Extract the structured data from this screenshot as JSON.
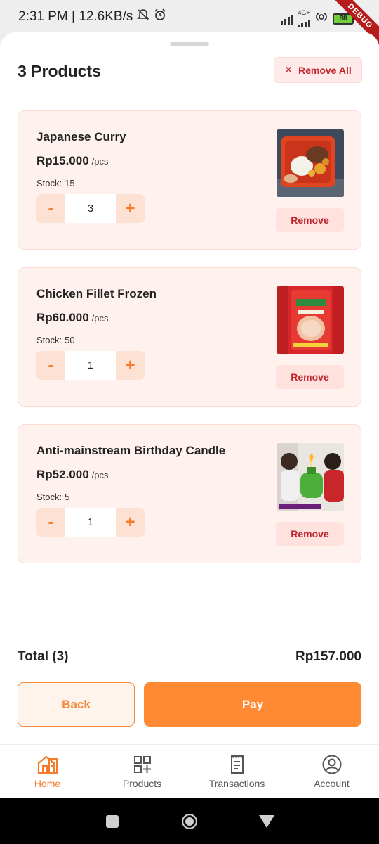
{
  "status_bar": {
    "time_speed": "2:31 PM | 12.6KB/s",
    "network": "4G+",
    "battery": "88",
    "debug_banner": "DEBUG"
  },
  "header": {
    "title": "3 Products",
    "remove_all_label": "Remove All"
  },
  "products": [
    {
      "name": "Japanese Curry",
      "price": "Rp15.000",
      "unit": "/pcs",
      "stock_label": "Stock:",
      "stock": "15",
      "quantity": "3",
      "minus": "-",
      "plus": "+",
      "remove_label": "Remove"
    },
    {
      "name": "Chicken Fillet Frozen",
      "price": "Rp60.000",
      "unit": "/pcs",
      "stock_label": "Stock:",
      "stock": "50",
      "quantity": "1",
      "minus": "-",
      "plus": "+",
      "remove_label": "Remove"
    },
    {
      "name": "Anti-mainstream Birthday Candle",
      "price": "Rp52.000",
      "unit": "/pcs",
      "stock_label": "Stock:",
      "stock": "5",
      "quantity": "1",
      "minus": "-",
      "plus": "+",
      "remove_label": "Remove"
    }
  ],
  "footer": {
    "total_label": "Total (3)",
    "total_value": "Rp157.000",
    "back_label": "Back",
    "pay_label": "Pay"
  },
  "bottom_nav": [
    {
      "label": "Home",
      "icon": "home-store-icon",
      "active": true
    },
    {
      "label": "Products",
      "icon": "qr-grid-icon",
      "active": false
    },
    {
      "label": "Transactions",
      "icon": "receipt-icon",
      "active": false
    },
    {
      "label": "Account",
      "icon": "account-circle-icon",
      "active": false
    }
  ],
  "colors": {
    "accent": "#ff8a33",
    "danger": "#c0252b",
    "card_bg": "#fff1ee"
  }
}
